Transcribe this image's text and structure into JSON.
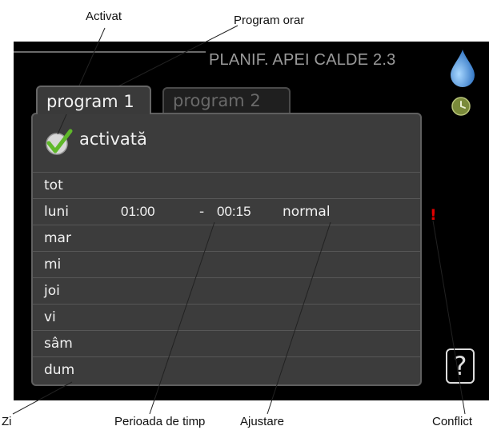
{
  "callouts": {
    "activated": "Activat",
    "program_schedule": "Program orar",
    "day": "Zi",
    "time_period": "Perioada de timp",
    "adjustment": "Ajustare",
    "conflict": "Conflict"
  },
  "screen": {
    "title": "PLANIF. APEI CALDE 2.3",
    "tabs": [
      {
        "label": "program 1",
        "active": true
      },
      {
        "label": "program 2",
        "active": false
      }
    ],
    "activated_label": "activată",
    "days": [
      {
        "name": "tot",
        "start": "",
        "end": "",
        "mode": ""
      },
      {
        "name": "luni",
        "start": "01:00",
        "end": "00:15",
        "mode": "normal"
      },
      {
        "name": "mar",
        "start": "",
        "end": "",
        "mode": ""
      },
      {
        "name": "mi",
        "start": "",
        "end": "",
        "mode": ""
      },
      {
        "name": "joi",
        "start": "",
        "end": "",
        "mode": ""
      },
      {
        "name": "vi",
        "start": "",
        "end": "",
        "mode": ""
      },
      {
        "name": "sâm",
        "start": "",
        "end": "",
        "mode": ""
      },
      {
        "name": "dum",
        "start": "",
        "end": "",
        "mode": ""
      }
    ],
    "dash": "-",
    "conflict_mark": "!",
    "help": "?",
    "icons": [
      "water-drop-icon",
      "clock-icon",
      "checkmark-icon"
    ],
    "colors": {
      "background": "#000000",
      "panel": "#3c3c3c",
      "conflict": "#e00000",
      "drop": "#3a8fd8",
      "clock": "#7a8a3a",
      "check": "#5fb82a"
    }
  }
}
